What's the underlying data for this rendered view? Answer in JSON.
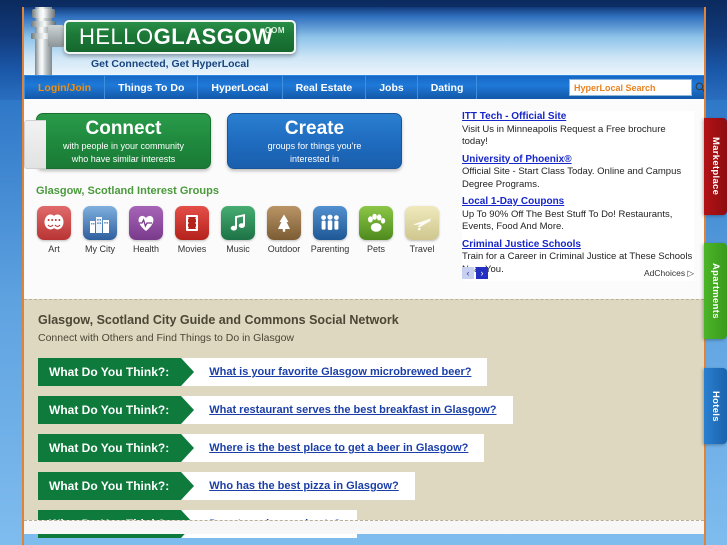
{
  "site": {
    "logo": {
      "part1": "HELLO",
      "part2": "GLASGOW",
      "dotcom": ".COM"
    },
    "tagline": "Get Connected, Get HyperLocal"
  },
  "nav": {
    "items": [
      {
        "label": "Login/Join",
        "active": true
      },
      {
        "label": "Things To Do",
        "active": false
      },
      {
        "label": "HyperLocal",
        "active": false
      },
      {
        "label": "Real Estate",
        "active": false
      },
      {
        "label": "Jobs",
        "active": false
      },
      {
        "label": "Dating",
        "active": false
      }
    ]
  },
  "search": {
    "placeholder": "HyperLocal Search",
    "value": "",
    "icon": "search-icon"
  },
  "cta": [
    {
      "title": "Connect",
      "sub_line1": "with people in your community",
      "sub_line2": "who have similar interests",
      "color": "#1f8a3e"
    },
    {
      "title": "Create",
      "sub_line1": "groups for things you're",
      "sub_line2": "interested in",
      "color": "#1f6cc0"
    }
  ],
  "interest_groups": {
    "title": "Glasgow, Scotland Interest Groups",
    "items": [
      {
        "label": "Art",
        "icon": "theater-masks-icon",
        "color": "#cf4a4a"
      },
      {
        "label": "My City",
        "icon": "city-buildings-icon",
        "color": "#4a7fc1"
      },
      {
        "label": "Health",
        "icon": "heart-pulse-icon",
        "color": "#8e4a9e"
      },
      {
        "label": "Movies",
        "icon": "film-strip-icon",
        "color": "#d03a33"
      },
      {
        "label": "Music",
        "icon": "music-note-icon",
        "color": "#2f8f5e"
      },
      {
        "label": "Outdoor",
        "icon": "pine-tree-icon",
        "color": "#9c7a4a"
      },
      {
        "label": "Parenting",
        "icon": "family-icon",
        "color": "#2f6fae"
      },
      {
        "label": "Pets",
        "icon": "paw-print-icon",
        "color": "#6aa82e"
      },
      {
        "label": "Travel",
        "icon": "airplane-icon",
        "color": "#ded9a8"
      }
    ]
  },
  "ads": {
    "items": [
      {
        "title": "ITT Tech - Official Site",
        "desc": "Visit Us in Minneapolis Request a Free brochure today!"
      },
      {
        "title": "University of Phoenix®",
        "desc": "Official Site - Start Class Today. Online and Campus Degree Programs."
      },
      {
        "title": "Local 1-Day Coupons",
        "desc": "Up To 90% Off The Best Stuff To Do! Restaurants, Events, Food And More."
      },
      {
        "title": "Criminal Justice Schools",
        "desc": "Train for a Career in Criminal Justice at These Schools Near You."
      }
    ],
    "prev_label": "‹",
    "next_label": "›",
    "adchoices_label": "AdChoices ▷"
  },
  "guide": {
    "heading": "Glasgow, Scotland City Guide and Commons Social Network",
    "subheading": "Connect with Others and Find Things to Do in Glasgow"
  },
  "questions": {
    "tag_label": "What Do You Think?:",
    "items": [
      {
        "text": "What is your favorite Glasgow microbrewed beer?"
      },
      {
        "text": "What restaurant serves the best breakfast in Glasgow?"
      },
      {
        "text": "Where is the best place to get a beer in Glasgow?"
      },
      {
        "text": "Who has the best pizza in Glasgow?"
      },
      {
        "text": "Do rats make good pets?"
      }
    ]
  },
  "side_tabs": [
    {
      "label": "Marketplace",
      "color": "#a6100f"
    },
    {
      "label": "Apartments",
      "color": "#45ad23"
    },
    {
      "label": "Hotels",
      "color": "#2479c6"
    }
  ]
}
